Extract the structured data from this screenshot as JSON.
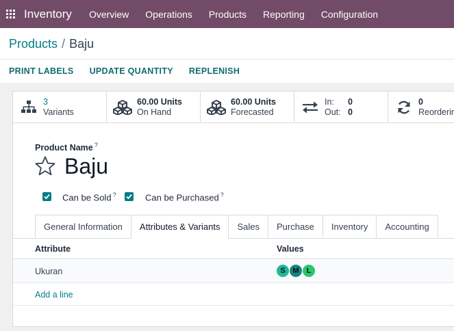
{
  "app": {
    "name": "Inventory",
    "menu": [
      "Overview",
      "Operations",
      "Products",
      "Reporting",
      "Configuration"
    ]
  },
  "breadcrumb": {
    "parent": "Products",
    "separator": "/",
    "current": "Baju"
  },
  "actions": [
    "PRINT LABELS",
    "UPDATE QUANTITY",
    "REPLENISH"
  ],
  "stats": {
    "variants": {
      "count": "3",
      "label": "Variants"
    },
    "on_hand": {
      "value": "60.00 Units",
      "label": "On Hand"
    },
    "forecasted": {
      "value": "60.00 Units",
      "label": "Forecasted"
    },
    "inout": {
      "in_label": "In:",
      "in_value": "0",
      "out_label": "Out:",
      "out_value": "0"
    },
    "reordering": {
      "count": "0",
      "label": "Reordering"
    }
  },
  "form": {
    "name_label": "Product Name",
    "help_mark": "?",
    "product_name": "Baju",
    "can_be_sold_label": "Can be Sold",
    "can_be_purchased_label": "Can be Purchased"
  },
  "tabs": [
    "General Information",
    "Attributes & Variants",
    "Sales",
    "Purchase",
    "Inventory",
    "Accounting"
  ],
  "active_tab": "Attributes & Variants",
  "attributes_table": {
    "headers": {
      "attribute": "Attribute",
      "values": "Values"
    },
    "rows": [
      {
        "attribute": "Ukuran",
        "values": [
          {
            "label": "S",
            "color": "#21b799"
          },
          {
            "label": "M",
            "color": "#0f8a7e"
          },
          {
            "label": "L",
            "color": "#28c76f"
          }
        ]
      }
    ],
    "add_line": "Add a line"
  },
  "colors": {
    "brand": "#714b67",
    "accent": "#017e84"
  }
}
